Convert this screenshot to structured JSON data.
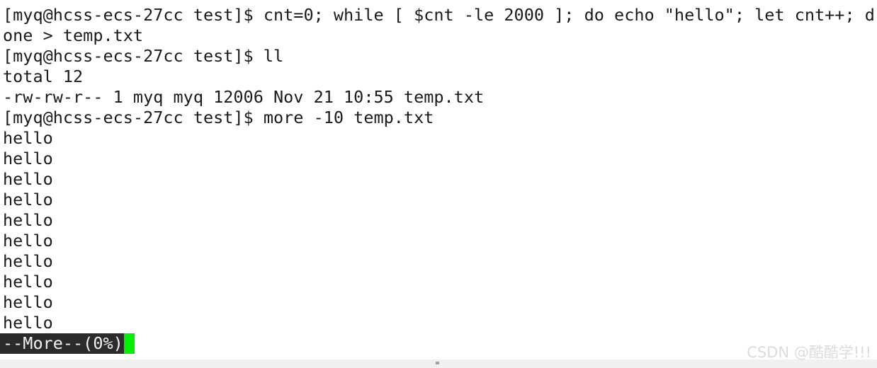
{
  "terminal": {
    "window_title": "",
    "background_color": "#ffffff",
    "text_color": "#1a1a1a",
    "cursor_color": "#00f000",
    "inverse_background_color": "#2b2b2b",
    "inverse_text_color": "#f2f2f2",
    "prompt": "[myq@hcss-ecs-27cc test]$",
    "user": "myq",
    "host": "hcss-ecs-27cc",
    "cwd": "test",
    "lines": [
      "[myq@hcss-ecs-27cc test]$ cnt=0; while [ $cnt -le 2000 ]; do echo \"hello\"; let cnt++; d",
      "one > temp.txt",
      "[myq@hcss-ecs-27cc test]$ ll",
      "total 12",
      "-rw-rw-r-- 1 myq myq 12006 Nov 21 10:55 temp.txt",
      "[myq@hcss-ecs-27cc test]$ more -10 temp.txt",
      "hello",
      "hello",
      "hello",
      "hello",
      "hello",
      "hello",
      "hello",
      "hello",
      "hello",
      "hello"
    ],
    "commands": [
      "cnt=0; while [ $cnt -le 2000 ]; do echo \"hello\"; let cnt++; done > temp.txt",
      "ll",
      "more -10 temp.txt"
    ],
    "listing": {
      "total_label": "total 12",
      "total_blocks": "12",
      "entries": [
        {
          "permissions": "-rw-rw-r--",
          "links": "1",
          "owner": "myq",
          "group": "myq",
          "size": "12006",
          "month": "Nov",
          "day": "21",
          "time": "10:55",
          "name": "temp.txt"
        }
      ]
    },
    "pager": {
      "prompt_text": "--More--(0%)",
      "percent": "0%",
      "cursor_glyph": " "
    }
  },
  "watermark": {
    "text": "CSDN @酷酷学!!!",
    "color": "#dcdcdc"
  }
}
